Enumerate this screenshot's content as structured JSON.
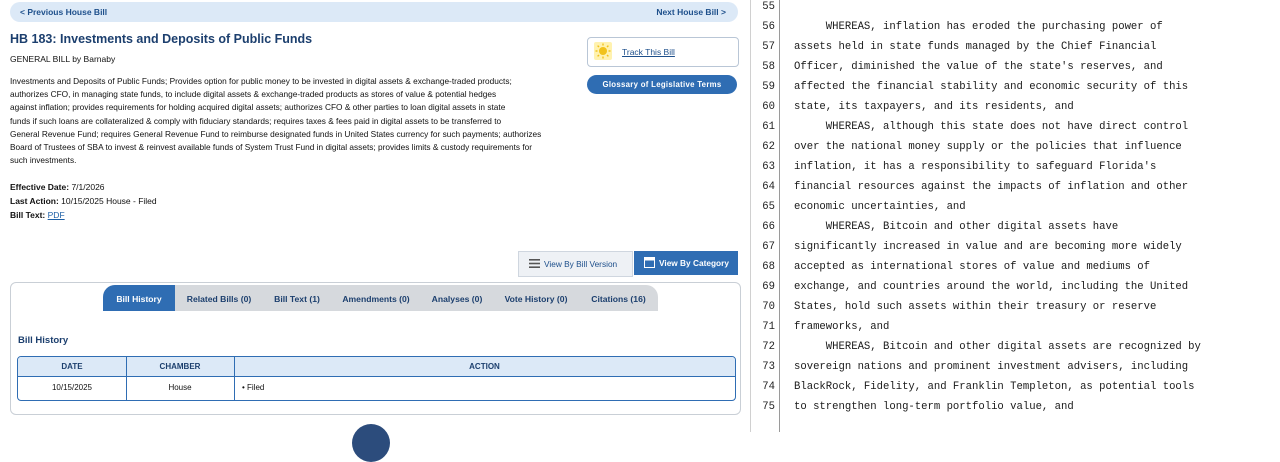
{
  "nav": {
    "prev": "< Previous House Bill",
    "next": "Next House Bill >"
  },
  "bill": {
    "title": "HB 183: Investments and Deposits of Public Funds",
    "subtitle": "GENERAL BILL by Barnaby",
    "description_lines": [
      "Investments and Deposits of Public Funds; Provides option for public money to be invested in digital assets & exchange-traded products;",
      "authorizes CFO, in managing state funds, to include digital assets & exchange-traded products as stores of value & potential hedges",
      "against inflation; provides requirements for holding acquired digital assets; authorizes CFO & other parties to loan digital assets in state",
      "funds if such loans are collateralized & comply with fiduciary standards; requires taxes & fees paid in digital assets to be transferred to",
      "General Revenue Fund; requires General Revenue Fund to reimburse designated funds in United States currency for such payments; authorizes",
      "Board of Trustees of SBA to invest & reinvest available funds of System Trust Fund in digital assets; provides limits & custody requirements for",
      "such investments."
    ],
    "effective_label": "Effective Date:",
    "effective_value": "7/1/2026",
    "last_action_label": "Last Action:",
    "last_action_value": "10/15/2025 House - Filed",
    "bill_text_label": "Bill Text:",
    "bill_text_link": "PDF"
  },
  "buttons": {
    "track": "Track This Bill",
    "glossary": "Glossary of Legislative Terms",
    "view_by_version": "View By Bill Version",
    "view_by_category": "View By Category"
  },
  "tabs": [
    {
      "label": "Bill History"
    },
    {
      "label": "Related Bills (0)"
    },
    {
      "label": "Bill Text (1)"
    },
    {
      "label": "Amendments (0)"
    },
    {
      "label": "Analyses (0)"
    },
    {
      "label": "Vote History (0)"
    },
    {
      "label": "Citations (16)"
    }
  ],
  "history": {
    "title": "Bill History",
    "headers": {
      "date": "DATE",
      "chamber": "CHAMBER",
      "action": "ACTION"
    },
    "row": {
      "date": "10/15/2025",
      "chamber": "House",
      "action": "• Filed"
    }
  },
  "doc": {
    "line_numbers": [
      "55",
      "56",
      "57",
      "58",
      "59",
      "60",
      "61",
      "62",
      "63",
      "64",
      "65",
      "66",
      "67",
      "68",
      "69",
      "70",
      "71",
      "72",
      "73",
      "74",
      "75"
    ],
    "lines": [
      "",
      "     WHEREAS, inflation has eroded the purchasing power of",
      "assets held in state funds managed by the Chief Financial",
      "Officer, diminished the value of the state's reserves, and",
      "affected the financial stability and economic security of this",
      "state, its taxpayers, and its residents, and",
      "     WHEREAS, although this state does not have direct control",
      "over the national money supply or the policies that influence",
      "inflation, it has a responsibility to safeguard Florida's",
      "financial resources against the impacts of inflation and other",
      "economic uncertainties, and",
      "     WHEREAS, Bitcoin and other digital assets have",
      "significantly increased in value and are becoming more widely",
      "accepted as international stores of value and mediums of",
      "exchange, and countries around the world, including the United",
      "States, hold such assets within their treasury or reserve",
      "frameworks, and",
      "     WHEREAS, Bitcoin and other digital assets are recognized by",
      "sovereign nations and prominent investment advisers, including",
      "BlackRock, Fidelity, and Franklin Templeton, as potential tools",
      "to strengthen long-term portfolio value, and"
    ]
  }
}
